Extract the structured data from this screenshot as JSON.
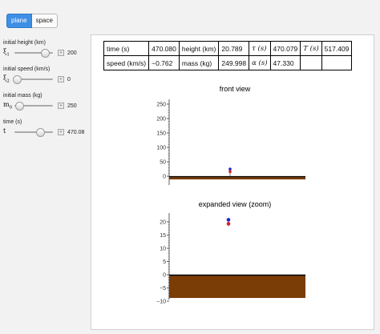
{
  "tabs": [
    {
      "label": "plane",
      "active": true
    },
    {
      "label": "space",
      "active": false
    }
  ],
  "controls": [
    {
      "label": "initial height (km)",
      "symbol": "ξ",
      "subscript": "1",
      "value": "200",
      "fraction": 0.8
    },
    {
      "label": "initial speed (km/s)",
      "symbol": "ξ",
      "subscript": "2",
      "value": "0",
      "fraction": 0.0
    },
    {
      "label": "initial mass (kg)",
      "symbol": "m",
      "subscript": "0",
      "value": "250",
      "fraction": 0.12
    },
    {
      "label": "time (s)",
      "symbol": "t",
      "subscript": "",
      "value": "470.08",
      "fraction": 0.67
    }
  ],
  "readout": {
    "row1": [
      {
        "text": "time (s)"
      },
      {
        "text": "470.080"
      },
      {
        "text": "height (km)"
      },
      {
        "text": "20.789"
      },
      {
        "text": "τ (s)",
        "sym": true
      },
      {
        "text": "470.079"
      },
      {
        "text": "T (s)",
        "sym": true
      },
      {
        "text": "517.409"
      }
    ],
    "row2": [
      {
        "text": "speed (km/s)"
      },
      {
        "text": "−0.762"
      },
      {
        "text": "mass (kg)"
      },
      {
        "text": "249.998"
      },
      {
        "text": "α (s)",
        "sym": true
      },
      {
        "text": "47.330"
      },
      {
        "text": ""
      },
      {
        "text": ""
      }
    ]
  },
  "front_view": {
    "title": "front view",
    "y_ticks": [
      "250",
      "200",
      "150",
      "100",
      "50",
      "0"
    ],
    "object_height_km": 20.789
  },
  "zoom_view": {
    "title": "expanded view (zoom)",
    "y_ticks": [
      "20",
      "15",
      "10",
      "5",
      "0",
      "−5",
      "−10"
    ],
    "object_height_km": 20.789
  },
  "colors": {
    "ground": "#7a3d06",
    "ground_edge": "#000000",
    "object_top": "#2323c8",
    "object_bottom": "#d82020",
    "tab_active": "#3f8fe6"
  }
}
